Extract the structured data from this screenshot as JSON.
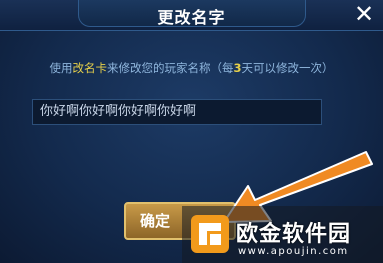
{
  "dialog": {
    "title": "更改名字",
    "close_label": "✕",
    "instruction": {
      "part1": "使用",
      "card_name": "改名卡",
      "part2": "来修改您的玩家名称（每",
      "days": "3",
      "part3": "天可以修改一次）"
    },
    "name_input": {
      "value": "你好啊你好啊你好啊你好啊"
    },
    "confirm_label": "确定"
  },
  "watermark": {
    "name": "欧金软件园",
    "url": "www.apoujin.com"
  },
  "colors": {
    "highlight": "#e6d04a",
    "instruction_text": "#8fb6dd",
    "button_gold": "#c89a48",
    "arrow_orange": "#f08a23",
    "logo_orange": "#f29a1b"
  },
  "icons": {
    "close": "close-icon",
    "arrow": "pointer-arrow-icon",
    "logo": "site-logo-icon"
  }
}
